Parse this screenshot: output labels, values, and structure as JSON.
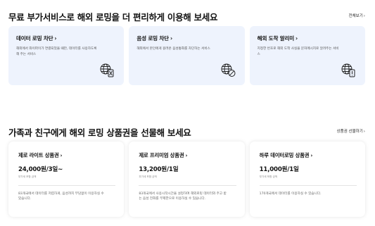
{
  "services": {
    "title": "무료 부가서비스로 해외 로밍을 더 편리하게 이용해 보세요",
    "more_label": "전체보기",
    "cards": [
      {
        "title": "데이터 로밍 차단",
        "desc": "해외에서 와이파이가 연결되었을 때만, 데이터를 사용하도록 해 주는 서비스",
        "icon": "globe-block-data-icon"
      },
      {
        "title": "음성 로밍 차단",
        "desc": "해외에서 본인에게 걸려온 음성통화를 차단하는 서비스",
        "icon": "globe-block-voice-icon"
      },
      {
        "title": "해외 도착 알리미",
        "desc": "지정한 번호로 해외 도착 사실을 문자메시지로 알려주는 서비스",
        "icon": "globe-alert-icon"
      }
    ]
  },
  "products": {
    "title": "가족과 친구에게 해외 로밍 상품권을 선물해 보세요",
    "more_label": "상품권 선물하기",
    "cards": [
      {
        "name": "제로 라이트 상품권",
        "price": "24,000원/3일~",
        "sub": "부가세 포함 금액",
        "desc": "83개국에서 데이터를 저렴하게, 음성까지 부담없이 이용하실 수 있습니다."
      },
      {
        "name": "제로 프리미엄 상품권",
        "price": "13,200원/1일",
        "sub": "부가세 포함 금액",
        "desc": "83개국에서 사용시작시간을 설정하여 해외로밍 데이터와 주고 받는 음성 전화를 무제한으로 이용하실 수 있습니다."
      },
      {
        "name": "하루 데이터로밍 상품권",
        "price": "11,000원/1일",
        "sub": "부가세 포함 금액",
        "desc": "170개국에서 데이터를 이용하실 수 있습니다."
      }
    ]
  },
  "ui": {
    "chevron": "›",
    "accent": "#eef3fd"
  }
}
